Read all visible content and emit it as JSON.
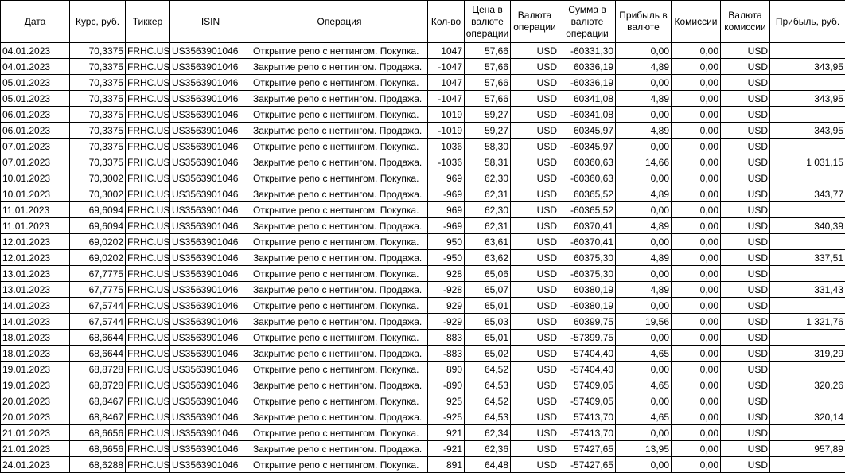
{
  "columns": [
    "Дата",
    "Курс, руб.",
    "Тиккер",
    "ISIN",
    "Операция",
    "Кол-во",
    "Цена в валюте операции",
    "Валюта операции",
    "Сумма в валюте операции",
    "Прибыль в валюте",
    "Комиссии",
    "Валюта комиссии",
    "Прибыль, руб."
  ],
  "rows": [
    [
      "04.01.2023",
      "70,3375",
      "FRHC.US",
      "US3563901046",
      "Открытие репо с неттингом. Покупка.",
      "1047",
      "57,66",
      "USD",
      "-60331,30",
      "0,00",
      "0,00",
      "USD",
      ""
    ],
    [
      "04.01.2023",
      "70,3375",
      "FRHC.US",
      "US3563901046",
      "Закрытие репо с неттингом. Продажа.",
      "-1047",
      "57,66",
      "USD",
      "60336,19",
      "4,89",
      "0,00",
      "USD",
      "343,95"
    ],
    [
      "05.01.2023",
      "70,3375",
      "FRHC.US",
      "US3563901046",
      "Открытие репо с неттингом. Покупка.",
      "1047",
      "57,66",
      "USD",
      "-60336,19",
      "0,00",
      "0,00",
      "USD",
      ""
    ],
    [
      "05.01.2023",
      "70,3375",
      "FRHC.US",
      "US3563901046",
      "Закрытие репо с неттингом. Продажа.",
      "-1047",
      "57,66",
      "USD",
      "60341,08",
      "4,89",
      "0,00",
      "USD",
      "343,95"
    ],
    [
      "06.01.2023",
      "70,3375",
      "FRHC.US",
      "US3563901046",
      "Открытие репо с неттингом. Покупка.",
      "1019",
      "59,27",
      "USD",
      "-60341,08",
      "0,00",
      "0,00",
      "USD",
      ""
    ],
    [
      "06.01.2023",
      "70,3375",
      "FRHC.US",
      "US3563901046",
      "Закрытие репо с неттингом. Продажа.",
      "-1019",
      "59,27",
      "USD",
      "60345,97",
      "4,89",
      "0,00",
      "USD",
      "343,95"
    ],
    [
      "07.01.2023",
      "70,3375",
      "FRHC.US",
      "US3563901046",
      "Открытие репо с неттингом. Покупка.",
      "1036",
      "58,30",
      "USD",
      "-60345,97",
      "0,00",
      "0,00",
      "USD",
      ""
    ],
    [
      "07.01.2023",
      "70,3375",
      "FRHC.US",
      "US3563901046",
      "Закрытие репо с неттингом. Продажа.",
      "-1036",
      "58,31",
      "USD",
      "60360,63",
      "14,66",
      "0,00",
      "USD",
      "1 031,15"
    ],
    [
      "10.01.2023",
      "70,3002",
      "FRHC.US",
      "US3563901046",
      "Открытие репо с неттингом. Покупка.",
      "969",
      "62,30",
      "USD",
      "-60360,63",
      "0,00",
      "0,00",
      "USD",
      ""
    ],
    [
      "10.01.2023",
      "70,3002",
      "FRHC.US",
      "US3563901046",
      "Закрытие репо с неттингом. Продажа.",
      "-969",
      "62,31",
      "USD",
      "60365,52",
      "4,89",
      "0,00",
      "USD",
      "343,77"
    ],
    [
      "11.01.2023",
      "69,6094",
      "FRHC.US",
      "US3563901046",
      "Открытие репо с неттингом. Покупка.",
      "969",
      "62,30",
      "USD",
      "-60365,52",
      "0,00",
      "0,00",
      "USD",
      ""
    ],
    [
      "11.01.2023",
      "69,6094",
      "FRHC.US",
      "US3563901046",
      "Закрытие репо с неттингом. Продажа.",
      "-969",
      "62,31",
      "USD",
      "60370,41",
      "4,89",
      "0,00",
      "USD",
      "340,39"
    ],
    [
      "12.01.2023",
      "69,0202",
      "FRHC.US",
      "US3563901046",
      "Открытие репо с неттингом. Покупка.",
      "950",
      "63,61",
      "USD",
      "-60370,41",
      "0,00",
      "0,00",
      "USD",
      ""
    ],
    [
      "12.01.2023",
      "69,0202",
      "FRHC.US",
      "US3563901046",
      "Закрытие репо с неттингом. Продажа.",
      "-950",
      "63,62",
      "USD",
      "60375,30",
      "4,89",
      "0,00",
      "USD",
      "337,51"
    ],
    [
      "13.01.2023",
      "67,7775",
      "FRHC.US",
      "US3563901046",
      "Открытие репо с неттингом. Покупка.",
      "928",
      "65,06",
      "USD",
      "-60375,30",
      "0,00",
      "0,00",
      "USD",
      ""
    ],
    [
      "13.01.2023",
      "67,7775",
      "FRHC.US",
      "US3563901046",
      "Закрытие репо с неттингом. Продажа.",
      "-928",
      "65,07",
      "USD",
      "60380,19",
      "4,89",
      "0,00",
      "USD",
      "331,43"
    ],
    [
      "14.01.2023",
      "67,5744",
      "FRHC.US",
      "US3563901046",
      "Открытие репо с неттингом. Покупка.",
      "929",
      "65,01",
      "USD",
      "-60380,19",
      "0,00",
      "0,00",
      "USD",
      ""
    ],
    [
      "14.01.2023",
      "67,5744",
      "FRHC.US",
      "US3563901046",
      "Закрытие репо с неттингом. Продажа.",
      "-929",
      "65,03",
      "USD",
      "60399,75",
      "19,56",
      "0,00",
      "USD",
      "1 321,76"
    ],
    [
      "18.01.2023",
      "68,6644",
      "FRHC.US",
      "US3563901046",
      "Открытие репо с неттингом. Покупка.",
      "883",
      "65,01",
      "USD",
      "-57399,75",
      "0,00",
      "0,00",
      "USD",
      ""
    ],
    [
      "18.01.2023",
      "68,6644",
      "FRHC.US",
      "US3563901046",
      "Закрытие репо с неттингом. Продажа.",
      "-883",
      "65,02",
      "USD",
      "57404,40",
      "4,65",
      "0,00",
      "USD",
      "319,29"
    ],
    [
      "19.01.2023",
      "68,8728",
      "FRHC.US",
      "US3563901046",
      "Открытие репо с неттингом. Покупка.",
      "890",
      "64,52",
      "USD",
      "-57404,40",
      "0,00",
      "0,00",
      "USD",
      ""
    ],
    [
      "19.01.2023",
      "68,8728",
      "FRHC.US",
      "US3563901046",
      "Закрытие репо с неттингом. Продажа.",
      "-890",
      "64,53",
      "USD",
      "57409,05",
      "4,65",
      "0,00",
      "USD",
      "320,26"
    ],
    [
      "20.01.2023",
      "68,8467",
      "FRHC.US",
      "US3563901046",
      "Открытие репо с неттингом. Покупка.",
      "925",
      "64,52",
      "USD",
      "-57409,05",
      "0,00",
      "0,00",
      "USD",
      ""
    ],
    [
      "20.01.2023",
      "68,8467",
      "FRHC.US",
      "US3563901046",
      "Закрытие репо с неттингом. Продажа.",
      "-925",
      "64,53",
      "USD",
      "57413,70",
      "4,65",
      "0,00",
      "USD",
      "320,14"
    ],
    [
      "21.01.2023",
      "68,6656",
      "FRHC.US",
      "US3563901046",
      "Открытие репо с неттингом. Покупка.",
      "921",
      "62,34",
      "USD",
      "-57413,70",
      "0,00",
      "0,00",
      "USD",
      ""
    ],
    [
      "21.01.2023",
      "68,6656",
      "FRHC.US",
      "US3563901046",
      "Закрытие репо с неттингом. Продажа.",
      "-921",
      "62,36",
      "USD",
      "57427,65",
      "13,95",
      "0,00",
      "USD",
      "957,89"
    ],
    [
      "24.01.2023",
      "68,6288",
      "FRHC.US",
      "US3563901046",
      "Открытие репо с неттингом. Покупка.",
      "891",
      "64,48",
      "USD",
      "-57427,65",
      "0,00",
      "0,00",
      "USD",
      ""
    ]
  ]
}
